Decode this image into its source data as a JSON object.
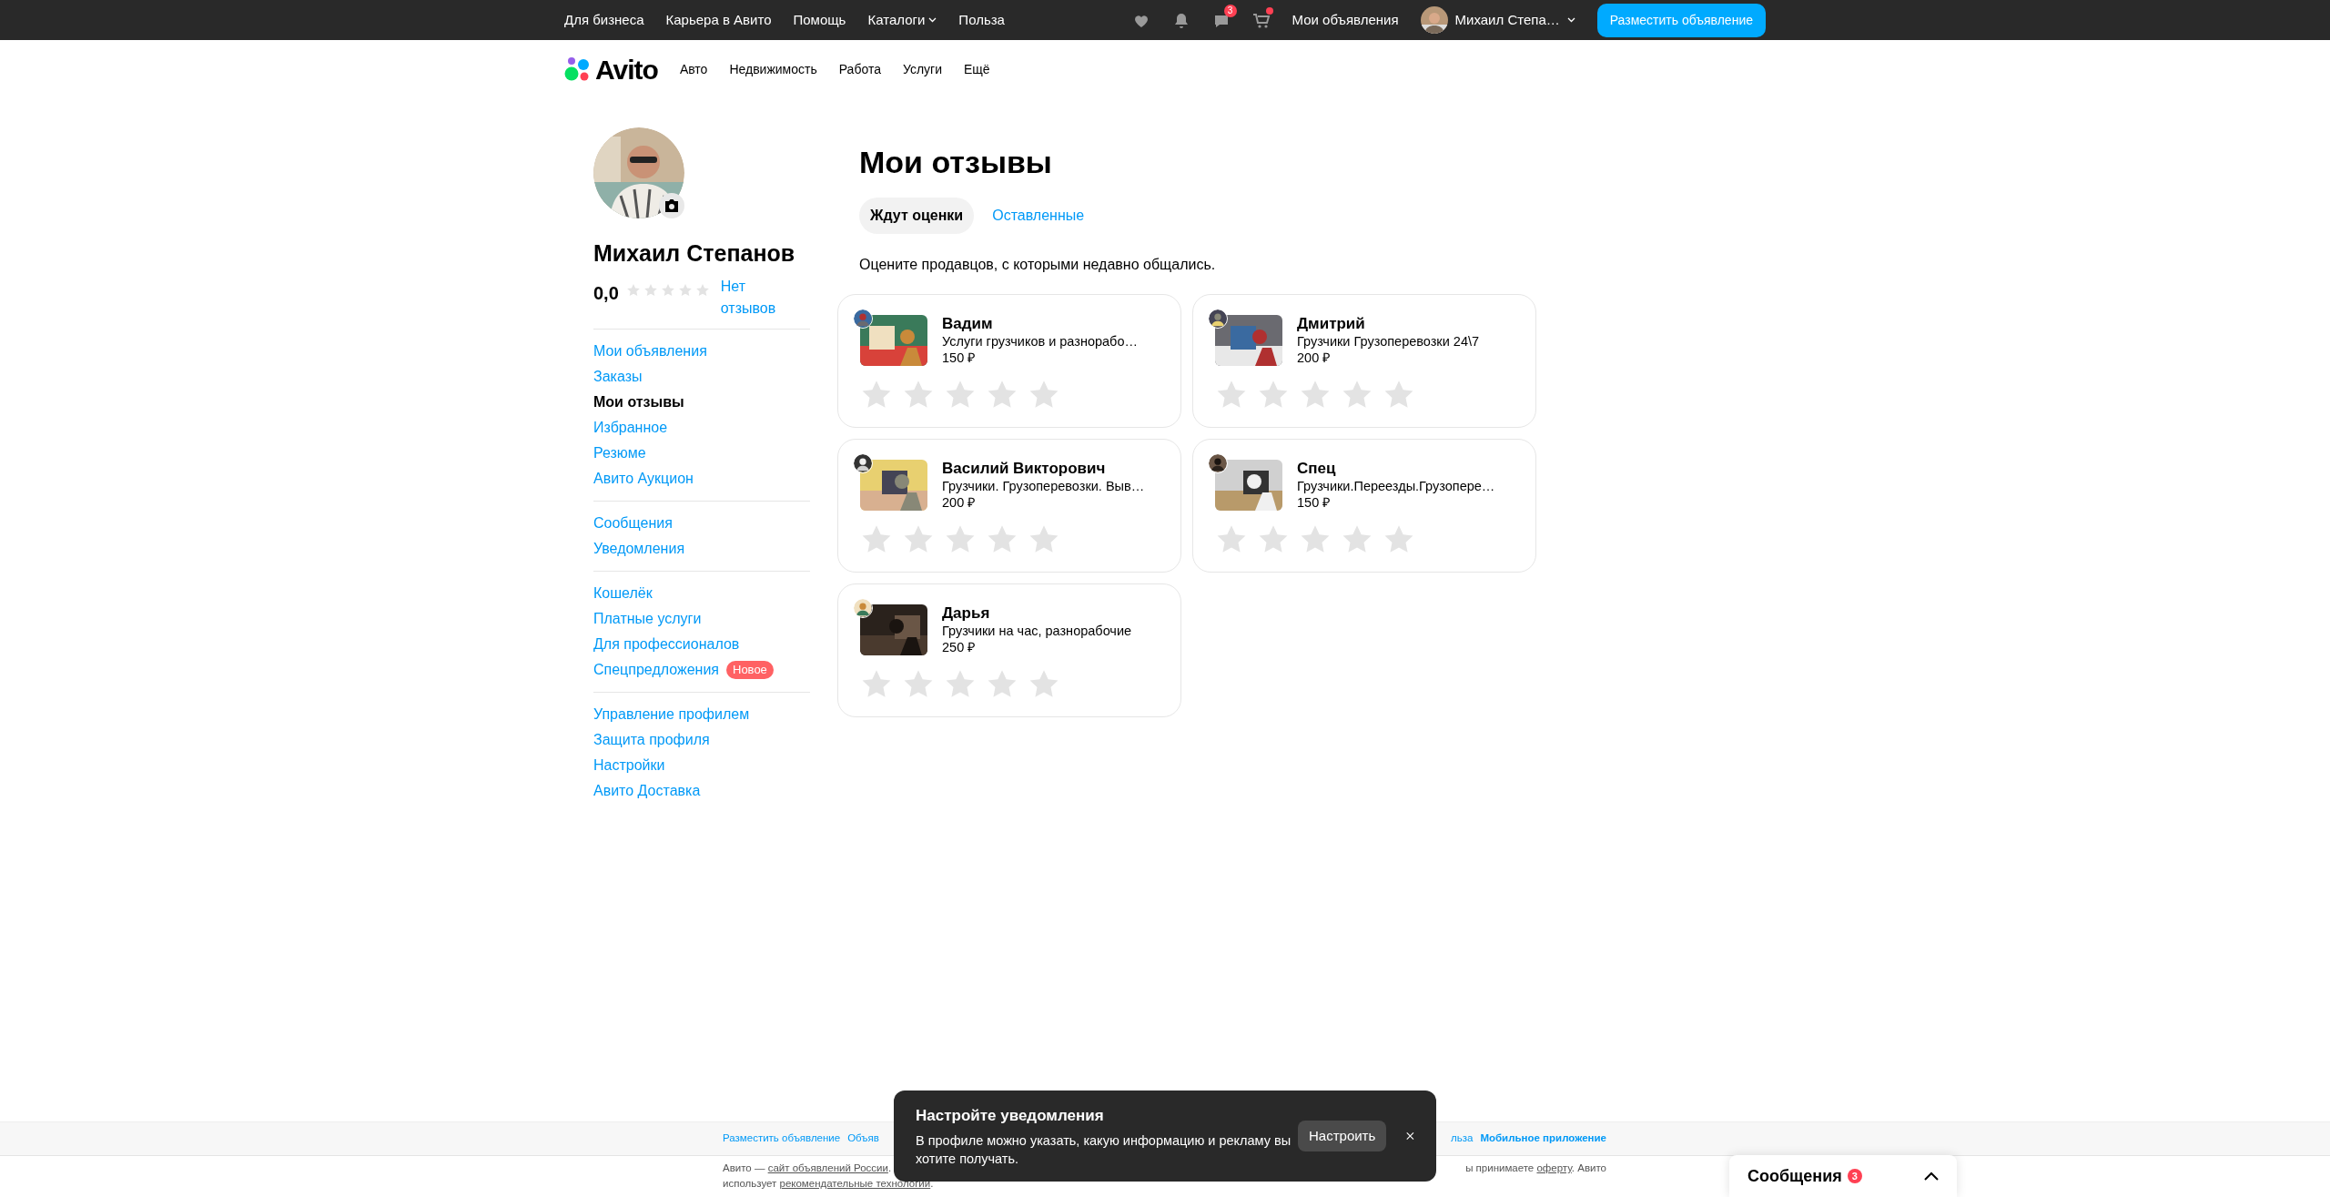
{
  "top_bar": {
    "links": [
      {
        "label": "Для бизнеса",
        "has_menu": false
      },
      {
        "label": "Карьера в Авито",
        "has_menu": false
      },
      {
        "label": "Помощь",
        "has_menu": false
      },
      {
        "label": "Каталоги",
        "has_menu": true
      },
      {
        "label": "Польза",
        "has_menu": false
      }
    ],
    "icons": [
      {
        "kind": "favorites",
        "dot": false
      },
      {
        "kind": "notifications",
        "dot": false
      },
      {
        "kind": "messages",
        "badge": "3",
        "dot": false
      },
      {
        "kind": "cart",
        "dot": true
      }
    ],
    "my_ads": "Мои объявления",
    "user": "Михаил Степа…",
    "post_button": "Разместить объявление"
  },
  "header": {
    "logo": "Avito",
    "nav": [
      "Авто",
      "Недвижимость",
      "Работа",
      "Услуги",
      "Ещё"
    ]
  },
  "profile": {
    "name": "Михаил Степанов",
    "rating": "0,0",
    "stars": 0,
    "reviews_link": "Нет отзывов"
  },
  "sidebar": {
    "groups": [
      [
        {
          "label": "Мои объявления",
          "selected": false
        },
        {
          "label": "Заказы",
          "selected": false
        },
        {
          "label": "Мои отзывы",
          "selected": true
        },
        {
          "label": "Избранное",
          "selected": false
        },
        {
          "label": "Резюме",
          "selected": false
        },
        {
          "label": "Авито Аукцион",
          "selected": false
        }
      ],
      [
        {
          "label": "Сообщения",
          "selected": false
        },
        {
          "label": "Уведомления",
          "selected": false
        }
      ],
      [
        {
          "label": "Кошелёк",
          "selected": false
        },
        {
          "label": "Платные услуги",
          "selected": false
        },
        {
          "label": "Для профессионалов",
          "selected": false
        },
        {
          "label": "Спецпредложения",
          "selected": false,
          "badge": "Новое"
        }
      ],
      [
        {
          "label": "Управление профилем",
          "selected": false
        },
        {
          "label": "Защита профиля",
          "selected": false
        },
        {
          "label": "Настройки",
          "selected": false
        },
        {
          "label": "Авито Доставка",
          "selected": false
        }
      ]
    ]
  },
  "page": {
    "title": "Мои отзывы",
    "tabs": [
      {
        "label": "Ждут оценки",
        "selected": true
      },
      {
        "label": "Оставленные",
        "selected": false
      }
    ],
    "hint": "Оцените продавцов, с которыми недавно общались.",
    "cards": [
      {
        "name": "Вадим",
        "title": "Услуги грузчиков и разнорабо…",
        "price": "150 ₽",
        "stars": 0
      },
      {
        "name": "Дмитрий",
        "title": "Грузчики Грузоперевозки 24\\7",
        "price": "200 ₽",
        "stars": 0
      },
      {
        "name": "Василий Викторович",
        "title": "Грузчики. Грузоперевозки. Выв…",
        "price": "200 ₽",
        "stars": 0
      },
      {
        "name": "Спец",
        "title": "Грузчики.Переезды.Грузопере…",
        "price": "150 ₽",
        "stars": 0
      },
      {
        "name": "Дарья",
        "title": "Грузчики на час, разнорабочие",
        "price": "250 ₽",
        "stars": 0
      }
    ]
  },
  "footer": {
    "links_left": [
      {
        "text": "Разместить объявление",
        "bold": false
      },
      {
        "text": "Объяв",
        "bold": false
      }
    ],
    "links_right": [
      {
        "text": "льза",
        "bold": false
      },
      {
        "text": "Мобильное приложение",
        "bold": true
      }
    ],
    "notice_lines": [
      [
        {
          "before": "Авито — ",
          "link": "сайт объявлений России",
          "after": "."
        },
        {
          "before": "ы принимаете ",
          "link": "оферту",
          "after": ". Авито"
        }
      ],
      [
        {
          "before": "использует ",
          "link": "рекомендательные технологии",
          "after": "."
        }
      ]
    ]
  },
  "toast": {
    "title": "Настройте уведомления",
    "text": "В профиле можно указать, какую информацию и рекламу вы хотите получать.",
    "button": "Настроить"
  },
  "messages_widget": {
    "label": "Сообщения",
    "badge": "3",
    "expanded": false
  }
}
